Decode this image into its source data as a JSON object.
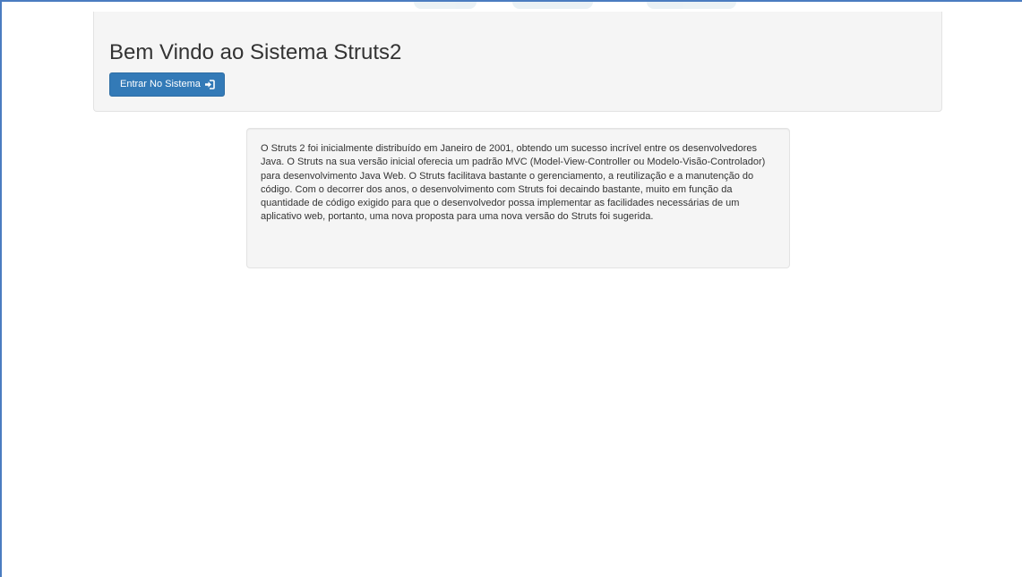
{
  "header": {
    "title": "Bem Vindo ao Sistema Struts2",
    "enter_button_label": "Entrar No Sistema",
    "enter_button_icon": "log-in-icon"
  },
  "content": {
    "description": "O Struts 2 foi inicialmente distribuído em Janeiro de 2001, obtendo um sucesso incrível entre os desenvolvedores Java. O Struts na sua versão inicial oferecia um padrão MVC (Model-View-Controller ou Modelo-Visão-Controlador) para desenvolvimento Java Web. O Struts facilitava bastante o gerenciamento, a reutilização e a manutenção do código. Com o decorrer dos anos, o desenvolvimento com Struts foi decaindo bastante, muito em função da quantidade de código exigido para que o desenvolvedor possa implementar as facilidades necessárias de um aplicativo web, portanto, uma nova proposta para uma nova versão do Struts foi sugerida."
  },
  "colors": {
    "primary_button": "#337ab7",
    "panel_background": "#f5f5f5",
    "frame_border": "#4a7cc0"
  }
}
